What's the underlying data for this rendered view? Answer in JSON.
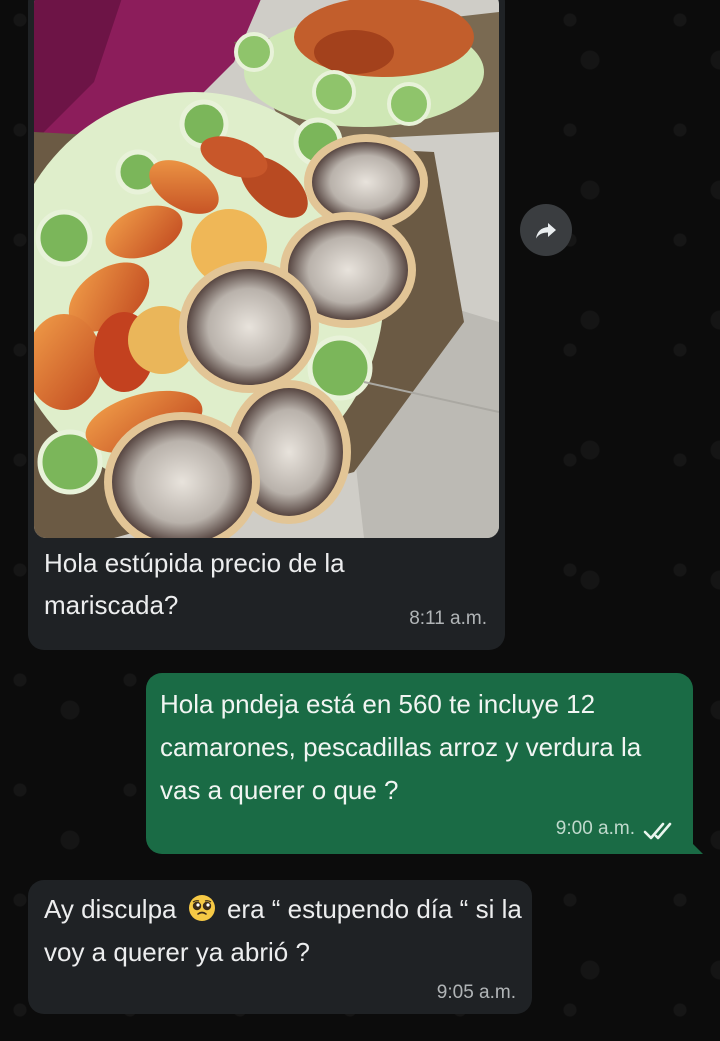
{
  "messages": {
    "incoming_image": {
      "caption": "Hola estúpida precio de la mariscada?",
      "time": "8:11 a.m."
    },
    "outgoing": {
      "text": "Hola pndeja está en 560 te incluye 12 camarones, pescadillas arroz y verdura la vas a querer o que ?",
      "time": "9:00 a.m.",
      "status_icon": "double-check-icon"
    },
    "incoming_text": {
      "text_before_emoji": "Ay disculpa",
      "emoji": "pleading-face",
      "text_after_emoji": "era “ estupendo día “ si la voy a querer ya abrió ?",
      "time": "9:05 a.m."
    }
  },
  "icons": {
    "forward": "forward-arrow-icon"
  },
  "colors": {
    "background": "#0c0c0c",
    "incoming_bubble": "#1f2225",
    "outgoing_bubble": "#1a6b45",
    "read_tick": "#e9f5ee"
  }
}
